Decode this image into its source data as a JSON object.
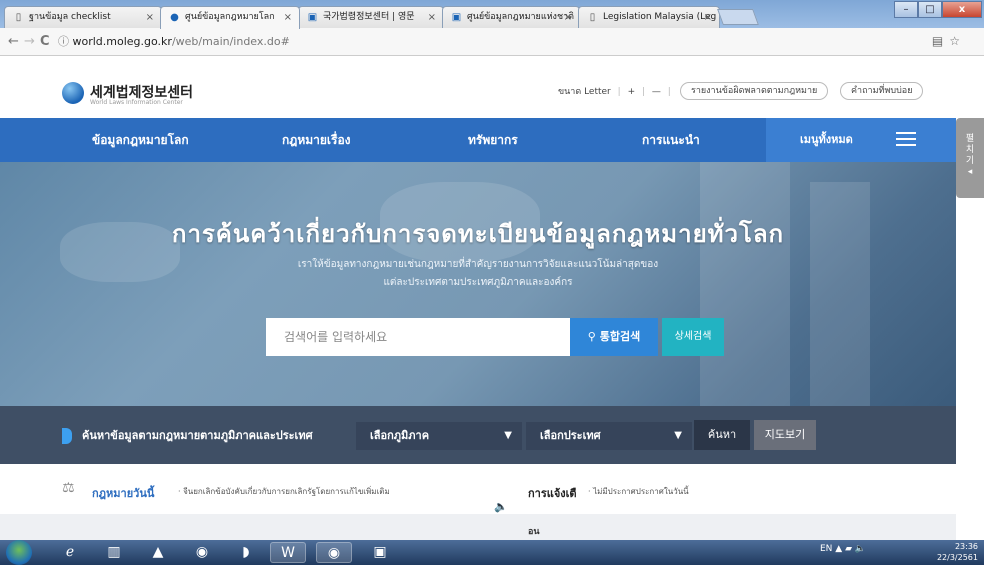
{
  "browser": {
    "tabs": [
      {
        "label": "ฐานข้อมูล checklist",
        "icon": "page-icon"
      },
      {
        "label": "ศูนย์ข้อมูลกฎหมายโลก",
        "icon": "site-icon"
      },
      {
        "label": "국가법령정보센터 | 영문",
        "icon": "site-icon"
      },
      {
        "label": "ศูนย์ข้อมูลกฎหมายแห่งชาติ",
        "icon": "site-icon"
      },
      {
        "label": "Legislation Malaysia (Leg",
        "icon": "page-icon"
      }
    ],
    "url_host": "world.moleg.go.kr",
    "url_path": "/web/main/index.do#",
    "nav": {
      "back": "←",
      "forward": "→",
      "reload": "C",
      "info": "ⓘ"
    },
    "win": {
      "min": "–",
      "max": "□",
      "close": "x"
    }
  },
  "site": {
    "logo_title": "세계법제정보센터",
    "logo_subtitle": "World Laws Information Center",
    "size_label": "ขนาด Letter",
    "zoom_in": "+",
    "zoom_out": "—",
    "report_error": "รายงานข้อผิดพลาดตามกฎหมาย",
    "faq": "คำถามที่พบบ่อย"
  },
  "nav": {
    "items": [
      "ข้อมูลกฎหมายโลก",
      "กฎหมายเรื่อง",
      "ทรัพยากร",
      "การแนะนำ"
    ],
    "all_menu": "เมนูทั้งหมด",
    "side_tab": "펼\n치\n기\n◂"
  },
  "hero": {
    "title": "การค้นคว้าเกี่ยวกับการจดทะเบียนข้อมูลกฎหมายทั่วโลก",
    "desc_line1": "เราให้ข้อมูลทางกฎหมายเช่นกฎหมายที่สำคัญรายงานการวิจัยและแนวโน้มล่าสุดของ",
    "desc_line2": "แต่ละประเทศตามประเทศภูมิภาคและองค์กร",
    "search_placeholder": "검색어를 입력하세요",
    "search_button": "통합검색",
    "advanced_button": "상세검색"
  },
  "filter": {
    "label": "ค้นหาข้อมูลตามกฎหมายตามภูมิภาคและประเทศ",
    "region": "เลือกภูมิภาค",
    "country": "เลือกประเทศ",
    "search": "ค้นหา",
    "map": "지도보기"
  },
  "info": {
    "today_label": "กฎหมายวันนี้",
    "today_text": "· จีนยกเลิกข้อบังคับเกี่ยวกับการยกเลิกรัฐโดยการแก้ไขเพิ่มเติม",
    "notice_label": "การแจ้งเตื",
    "notice_text": "· ไม่มีประกาศประกาศในวันนี้",
    "strip_text": "อน"
  },
  "taskbar": {
    "lang": "EN",
    "time": "23:36",
    "date": "22/3/2561"
  }
}
